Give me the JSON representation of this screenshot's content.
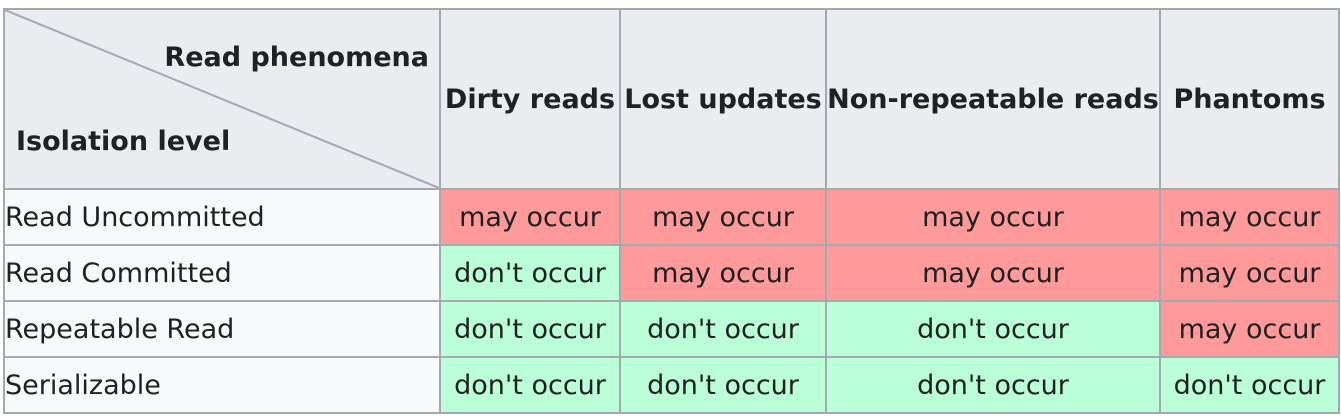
{
  "table": {
    "corner": {
      "top_label": "Read phenomena",
      "bottom_label": "Isolation level"
    },
    "columns": [
      "Dirty reads",
      "Lost updates",
      "Non-repeatable reads",
      "Phantoms"
    ],
    "rows": [
      {
        "level": "Read Uncommitted",
        "cells": [
          "may occur",
          "may occur",
          "may occur",
          "may occur"
        ]
      },
      {
        "level": "Read Committed",
        "cells": [
          "don't occur",
          "may occur",
          "may occur",
          "may occur"
        ]
      },
      {
        "level": "Repeatable Read",
        "cells": [
          "don't occur",
          "don't occur",
          "don't occur",
          "may occur"
        ]
      },
      {
        "level": "Serializable",
        "cells": [
          "don't occur",
          "don't occur",
          "don't occur",
          "don't occur"
        ]
      }
    ]
  },
  "colors": {
    "may_occur": "#ff9a9a",
    "dont_occur": "#bbffd9",
    "header_bg": "#eaecf0",
    "row_header_bg": "#f8f9fa",
    "border": "#a2a9b1"
  }
}
